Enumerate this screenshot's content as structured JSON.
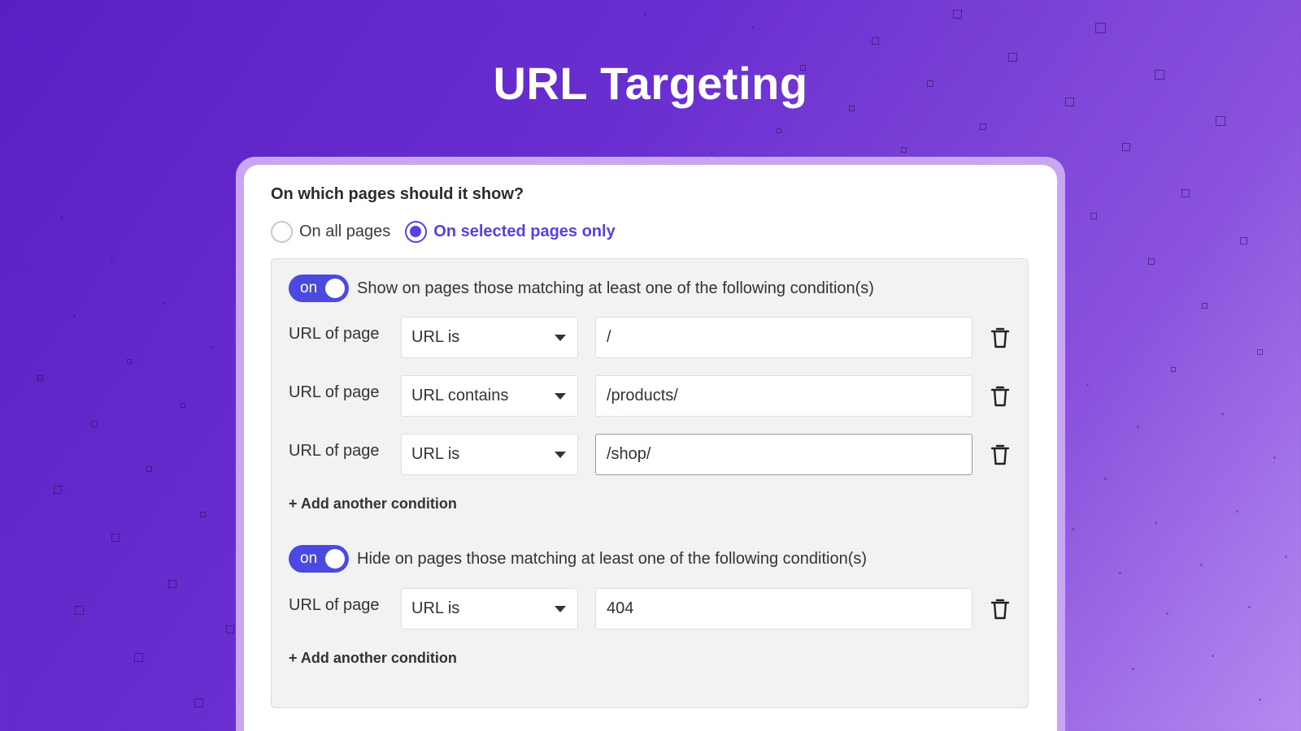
{
  "title": "URL Targeting",
  "question": "On which pages should it show?",
  "radio_options": [
    {
      "label": "On all pages",
      "selected": false
    },
    {
      "label": "On selected pages only",
      "selected": true
    }
  ],
  "show_section": {
    "toggle_label": "on",
    "description": "Show on pages those matching at least one of the following condition(s)",
    "conditions": [
      {
        "label": "URL of page",
        "operator": "URL is",
        "value": "/"
      },
      {
        "label": "URL of page",
        "operator": "URL contains",
        "value": "/products/"
      },
      {
        "label": "URL of page",
        "operator": "URL is",
        "value": "/shop/"
      }
    ],
    "add_label": "+ Add another condition"
  },
  "hide_section": {
    "toggle_label": "on",
    "description": "Hide on pages those matching at least one of the following condition(s)",
    "conditions": [
      {
        "label": "URL of page",
        "operator": "URL is",
        "value": "404"
      }
    ],
    "add_label": "+ Add another condition"
  },
  "colors": {
    "accent": "#5b3fe0",
    "toggle": "#4a4ae0",
    "background_start": "#5a1fc4",
    "background_end": "#b48af0"
  },
  "icons": {
    "condition_delete": "trash-icon",
    "operator_dropdown": "caret-down-icon"
  }
}
